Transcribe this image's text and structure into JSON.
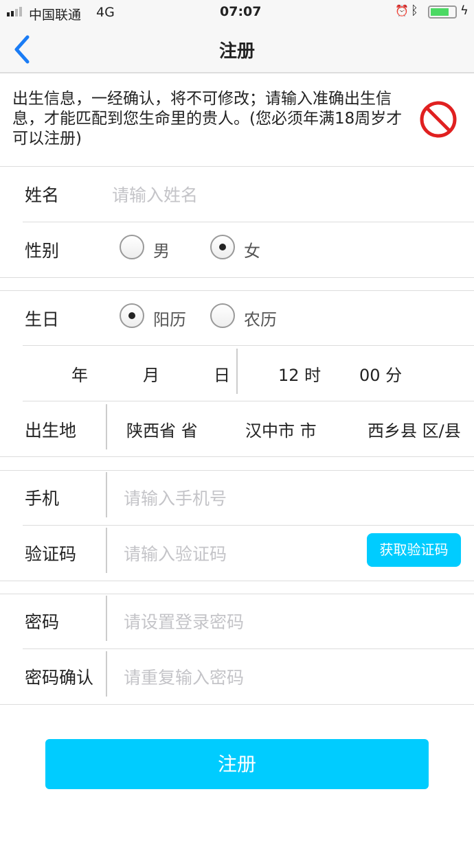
{
  "status_bar": {
    "carrier": "中国联通",
    "network": "4G",
    "time": "07:07",
    "battery_color": "#4cd964"
  },
  "nav": {
    "title": "注册",
    "back_icon": "chevron-left-icon",
    "accent": "#1a7cf5"
  },
  "notice": {
    "text": "出生信息，一经确认，将不可修改；请输入准确出生信息，才能匹配到您生命里的贵人。(您必须年满18周岁才可以注册)",
    "icon": "prohibited-icon"
  },
  "form": {
    "name": {
      "label": "姓名",
      "placeholder": "请输入姓名"
    },
    "gender": {
      "label": "性别",
      "options": [
        "男",
        "女"
      ],
      "selected": "女"
    },
    "birthday": {
      "label": "生日",
      "options": [
        "阳历",
        "农历"
      ],
      "selected": "阳历"
    },
    "date": {
      "year": "年",
      "month": "月",
      "day": "日",
      "hour": "12 时",
      "minute": "00 分"
    },
    "birthplace": {
      "label": "出生地",
      "province": "陕西省 省",
      "city": "汉中市 市",
      "county": "西乡县 区/县"
    },
    "phone": {
      "label": "手机",
      "placeholder": "请输入手机号"
    },
    "code": {
      "label": "验证码",
      "placeholder": "请输入验证码",
      "button": "获取验证码"
    },
    "password": {
      "label": "密码",
      "placeholder": "请设置登录密码"
    },
    "confirm": {
      "label": "密码确认",
      "placeholder": "请重复输入密码"
    }
  },
  "submit": {
    "label": "注册",
    "color": "#00ccff"
  }
}
